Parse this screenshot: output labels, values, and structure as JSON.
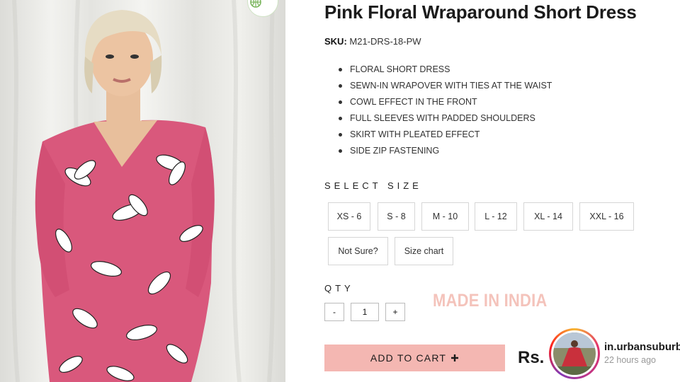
{
  "product": {
    "title": "Pink Floral Wraparound Short Dress",
    "sku_label": "SKU:",
    "sku_value": "M21-DRS-18-PW",
    "features": [
      "FLORAL SHORT DRESS",
      "SEWN-IN WRAPOVER WITH TIES AT THE WAIST",
      "COWL EFFECT IN THE FRONT",
      "FULL SLEEVES WITH PADDED SHOULDERS",
      "SKIRT WITH PLEATED EFFECT",
      "SIDE ZIP FASTENING"
    ]
  },
  "size": {
    "label": "SELECT SIZE",
    "options": [
      "XS - 6",
      "S - 8",
      "M - 10",
      "L - 12",
      "XL - 14",
      "XXL - 16"
    ],
    "not_sure": "Not Sure?",
    "size_chart": "Size chart"
  },
  "qty": {
    "label": "QTY",
    "minus": "-",
    "value": "1",
    "plus": "+"
  },
  "badge_text": "MADE IN INDIA",
  "cart": {
    "label": "ADD TO CART",
    "icon": "plus-icon"
  },
  "price": {
    "currency": "Rs."
  },
  "notification": {
    "handle": "in.urbansuburb",
    "time": "22 hours ago"
  },
  "colors": {
    "dress": "#d9587c",
    "cart_button": "#f4b7b2",
    "made_in_text": "#f4c3bb"
  }
}
